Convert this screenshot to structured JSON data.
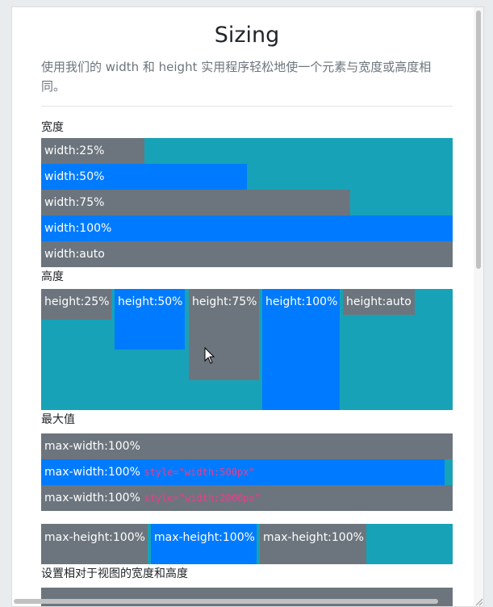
{
  "page": {
    "title": "Sizing",
    "lead": "使用我们的 width 和 height 实用程序轻松地使一个元素与宽度或高度相同。"
  },
  "width_section": {
    "label": "宽度",
    "bars": [
      {
        "label": "width:25%",
        "fraction": 0.25,
        "color": "grey"
      },
      {
        "label": "width:50%",
        "fraction": 0.5,
        "color": "blue"
      },
      {
        "label": "width:75%",
        "fraction": 0.75,
        "color": "grey"
      },
      {
        "label": "width:100%",
        "fraction": 1.0,
        "color": "blue"
      },
      {
        "label": "width:auto",
        "fraction": 1.0,
        "color": "grey"
      }
    ]
  },
  "height_section": {
    "label": "高度",
    "items": [
      {
        "label": "height:25%",
        "fraction": 0.25,
        "color": "grey"
      },
      {
        "label": "height:50%",
        "fraction": 0.5,
        "color": "blue"
      },
      {
        "label": "height:75%",
        "fraction": 0.75,
        "color": "grey"
      },
      {
        "label": "height:100%",
        "fraction": 1.0,
        "color": "blue"
      },
      {
        "label": "height:auto",
        "fraction": 0.21,
        "color": "grey"
      }
    ]
  },
  "max_section": {
    "label": "最大值",
    "rows": [
      {
        "label": "max-width:100%",
        "code": ""
      },
      {
        "label": "max-width:100%",
        "code": "style=\"width:500px\""
      },
      {
        "label": "max-width:100%",
        "code": "style=\"width:2000px\""
      }
    ],
    "max_height": [
      {
        "label": "max-height:100%"
      },
      {
        "label": "max-height:100%"
      },
      {
        "label": "max-height:100%"
      }
    ]
  },
  "viewport_section": {
    "label": "设置相对于视图的宽度和高度"
  },
  "colors": {
    "grey": "#6c757d",
    "blue": "#007bff",
    "teal": "#17a2b8",
    "code": "#e83e8c"
  }
}
